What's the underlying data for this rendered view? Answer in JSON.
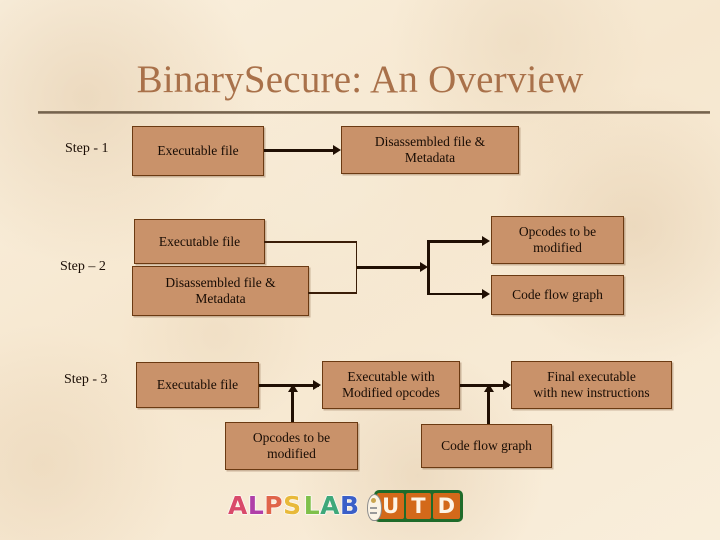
{
  "slide": {
    "title": "BinarySecure: An Overview",
    "background_color": "#f8ead4",
    "title_color": "#a9714a",
    "box_fill": "#c9926a",
    "box_border": "#6b3a12",
    "arrow_color": "#200f03"
  },
  "steps": [
    {
      "label": "Step - 1",
      "boxes": [
        {
          "id": "s1-executable-file",
          "text": "Executable file"
        },
        {
          "id": "s1-disassembled",
          "text": "Disassembled file & Metadata",
          "line1": "Disassembled file &",
          "line2": "Metadata"
        }
      ]
    },
    {
      "label": "Step – 2",
      "boxes": [
        {
          "id": "s2-executable-file",
          "text": "Executable file"
        },
        {
          "id": "s2-disassembled",
          "text": "Disassembled file & Metadata",
          "line1": "Disassembled file &",
          "line2": "Metadata"
        },
        {
          "id": "s2-opcodes",
          "text": "Opcodes to be modified",
          "line1": "Opcodes to be",
          "line2": "modified"
        },
        {
          "id": "s2-codeflow",
          "text": "Code flow graph"
        }
      ]
    },
    {
      "label": "Step - 3",
      "boxes": [
        {
          "id": "s3-executable-file",
          "text": "Executable file"
        },
        {
          "id": "s3-exec-modified",
          "text": "Executable with Modified opcodes",
          "line1": "Executable with",
          "line2": "Modified opcodes"
        },
        {
          "id": "s3-final-exec",
          "text": "Final executable with new instructions",
          "line1": "Final executable",
          "line2": "with new instructions"
        },
        {
          "id": "s3-opcodes",
          "text": "Opcodes to be modified",
          "line1": "Opcodes to be",
          "line2": "modified"
        },
        {
          "id": "s3-codeflow",
          "text": "Code flow graph"
        }
      ]
    }
  ],
  "logo": {
    "word_letters": [
      {
        "char": "A",
        "color": "#d94a6a"
      },
      {
        "char": "L",
        "color": "#b03fa8"
      },
      {
        "char": "P",
        "color": "#e0654a"
      },
      {
        "char": "S",
        "color": "#e8b93a"
      },
      {
        "char": "L",
        "color": "#7fc04a"
      },
      {
        "char": "A",
        "color": "#3fa87a"
      },
      {
        "char": "B",
        "color": "#3b5fc8"
      }
    ],
    "word_text": "ALPS LAB",
    "mark_name": "alps-lab-emblem",
    "utd_letters": [
      "U",
      "T",
      "D"
    ],
    "utd_text": "UTD",
    "utd_badge_color": "#1f6b2a",
    "utd_cell_color": "#d3691a"
  }
}
